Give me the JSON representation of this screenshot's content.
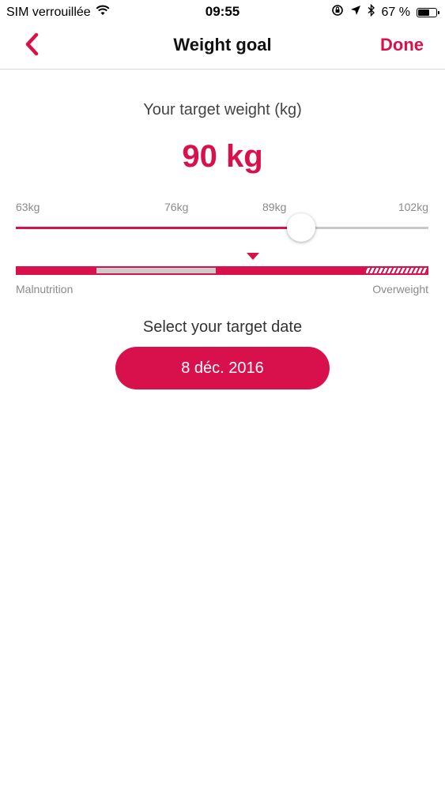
{
  "status_bar": {
    "carrier": "SIM verrouillée",
    "time": "09:55",
    "battery_percent": "67 %",
    "battery_level": 0.67
  },
  "nav": {
    "title": "Weight goal",
    "done_label": "Done"
  },
  "target": {
    "label": "Your target weight (kg)",
    "value": "90 kg"
  },
  "scale": {
    "ticks": [
      "63kg",
      "76kg",
      "89kg",
      "102kg"
    ],
    "min": 63,
    "max": 102,
    "current": 90
  },
  "bmi": {
    "left_label": "Malnutrition",
    "right_label": "Overweight"
  },
  "date": {
    "label": "Select your target date",
    "value": "8 déc. 2016"
  },
  "colors": {
    "accent": "#d8114c",
    "track": "#c8c8c8"
  }
}
